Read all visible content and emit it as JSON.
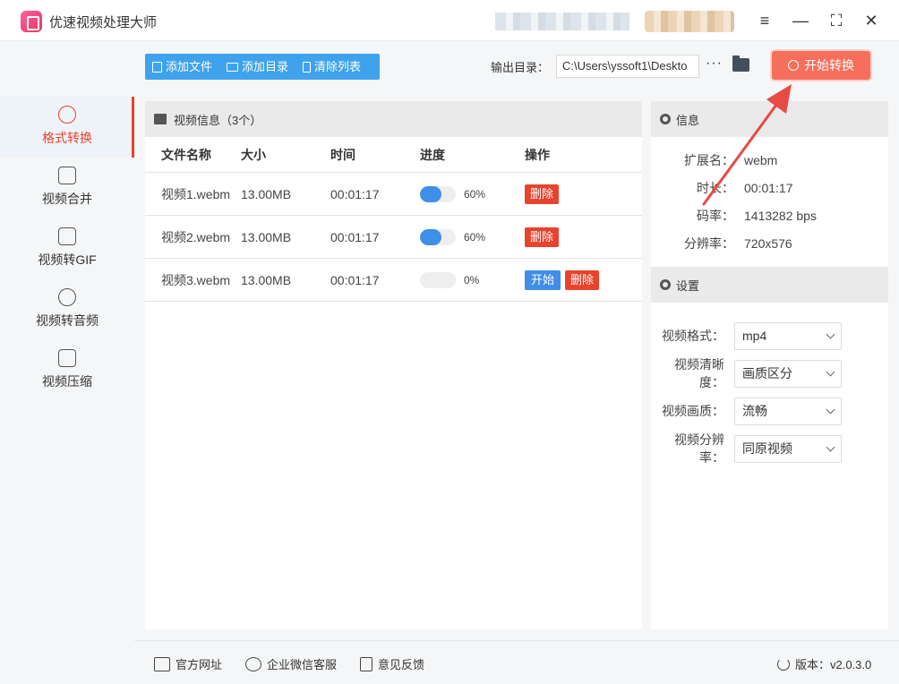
{
  "app": {
    "title": "优速视频处理大师"
  },
  "sidebar": {
    "items": [
      {
        "label": "格式转换",
        "icon": "convert-icon",
        "active": true
      },
      {
        "label": "视频合并",
        "icon": "merge-icon"
      },
      {
        "label": "视频转GIF",
        "icon": "gif-icon"
      },
      {
        "label": "视频转音频",
        "icon": "audio-icon"
      },
      {
        "label": "视频压缩",
        "icon": "compress-icon"
      }
    ]
  },
  "toolbar": {
    "add_file": "添加文件",
    "add_dir": "添加目录",
    "clear_list": "清除列表",
    "output_label": "输出目录：",
    "output_path": "C:\\Users\\yssoft1\\Deskto",
    "more": "···",
    "start": "开始转换"
  },
  "file_panel": {
    "title": "视频信息（3个）",
    "columns": {
      "name": "文件名称",
      "size": "大小",
      "time": "时间",
      "progress": "进度",
      "ops": "操作"
    },
    "rows": [
      {
        "name": "视频1.webm",
        "size": "13.00MB",
        "time": "00:01:17",
        "progress": "60%",
        "progress_value": 0.6,
        "delete": "删除"
      },
      {
        "name": "视频2.webm",
        "size": "13.00MB",
        "time": "00:01:17",
        "progress": "60%",
        "progress_value": 0.6,
        "delete": "删除"
      },
      {
        "name": "视频3.webm",
        "size": "13.00MB",
        "time": "00:01:17",
        "progress": "0%",
        "progress_value": 0,
        "start": "开始",
        "delete": "删除"
      }
    ]
  },
  "info": {
    "title": "信息",
    "ext_label": "扩展名：",
    "ext": "webm",
    "dur_label": "时长：",
    "dur": "00:01:17",
    "rate_label": "码率：",
    "rate": "1413282 bps",
    "res_label": "分辨率：",
    "res": "720x576"
  },
  "settings": {
    "title": "设置",
    "format_label": "视频格式：",
    "format": "mp4",
    "clarity_label": "视频清晰度：",
    "clarity": "画质区分",
    "quality_label": "视频画质：",
    "quality": "流畅",
    "resolution_label": "视频分辨率：",
    "resolution": "同原视频"
  },
  "footer": {
    "website": "官方网址",
    "wechat": "企业微信客服",
    "feedback": "意见反馈",
    "version": "版本：v2.0.3.0"
  },
  "colors": {
    "accent": "#e8432c",
    "primary": "#3f8ee8",
    "toolbar": "#3fa2ec",
    "start": "#f76f5b"
  }
}
